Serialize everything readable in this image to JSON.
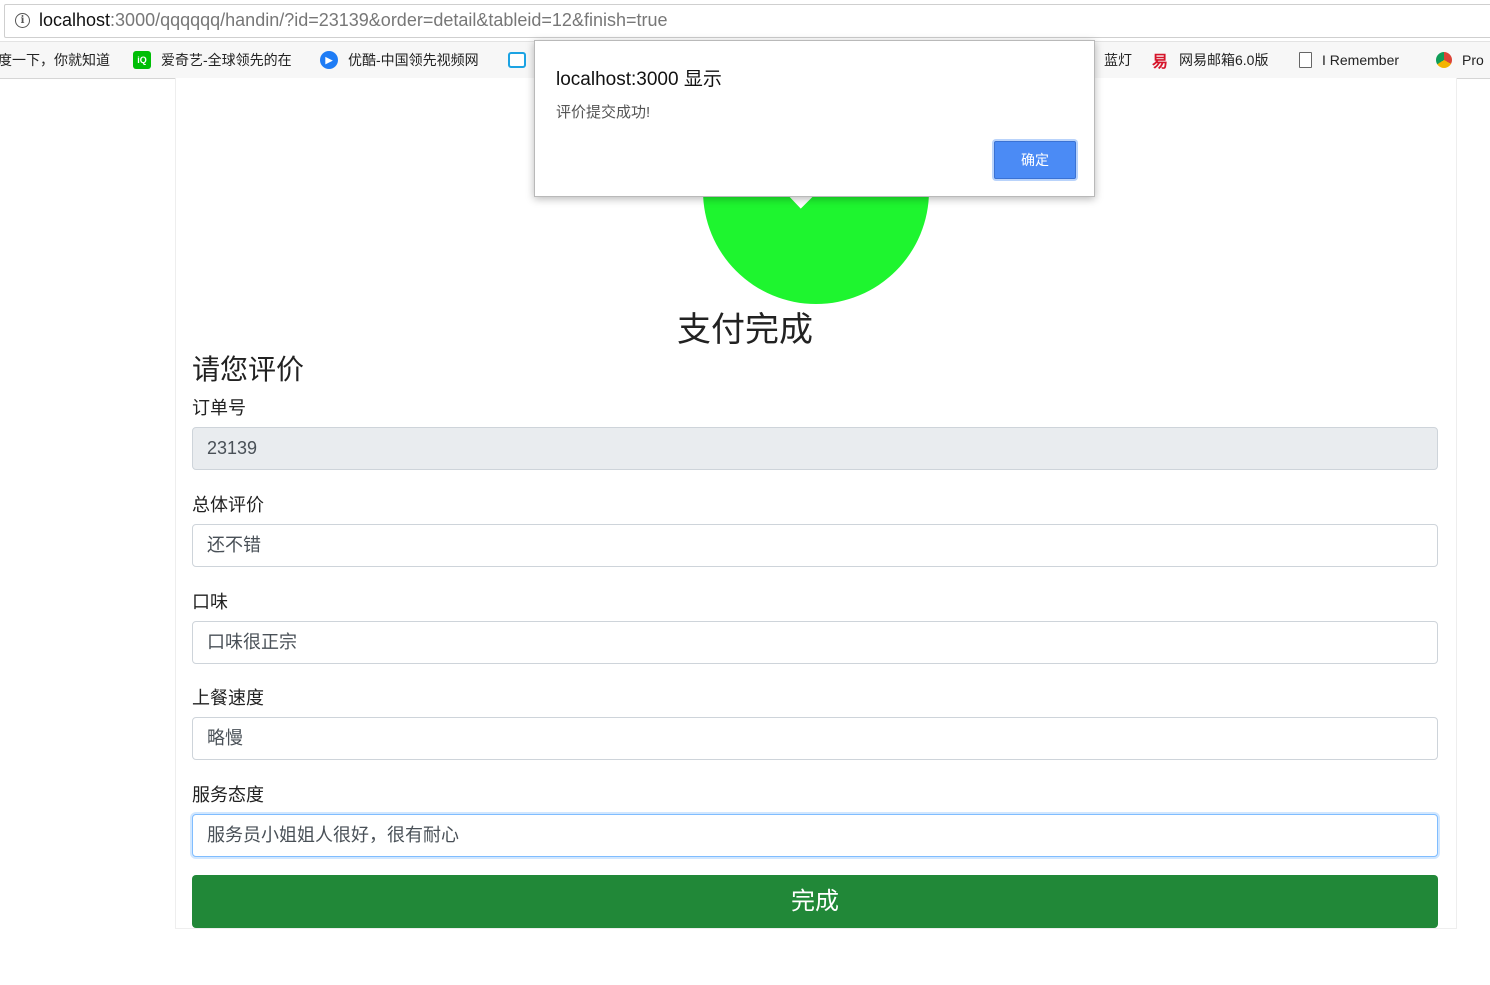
{
  "browser": {
    "url_host": "localhost",
    "url_path": ":3000/qqqqqq/handin/?id=23139&order=detail&tableid=12&finish=true",
    "bookmarks": [
      {
        "label": "度一下，你就知道",
        "icon": "baidu-icon"
      },
      {
        "label": "爱奇艺-全球领先的在",
        "icon": "iqiyi-icon"
      },
      {
        "label": "优酷-中国领先视频网",
        "icon": "youku-icon"
      },
      {
        "label": "",
        "icon": "bilibili-icon"
      },
      {
        "label": "蓝灯",
        "icon": ""
      },
      {
        "label": "网易邮箱6.0版",
        "icon": "netease-mail-icon"
      },
      {
        "label": "I Remember",
        "icon": "page-icon"
      },
      {
        "label": "Pro",
        "icon": "chrome-icon"
      }
    ]
  },
  "page": {
    "success_text": "支付完成",
    "success_color": "#1ef52f",
    "section_title": "请您评价",
    "fields": [
      {
        "label": "订单号",
        "value": "23139",
        "readonly": true
      },
      {
        "label": "总体评价",
        "value": "还不错"
      },
      {
        "label": "口味",
        "value": "口味很正宗"
      },
      {
        "label": "上餐速度",
        "value": "略慢"
      },
      {
        "label": "服务态度",
        "value": "服务员小姐姐人很好，很有耐心",
        "focused": true
      }
    ],
    "submit_label": "完成",
    "submit_color": "#218838"
  },
  "dialog": {
    "title": "localhost:3000 显示",
    "message": "评价提交成功!",
    "ok_label": "确定"
  }
}
